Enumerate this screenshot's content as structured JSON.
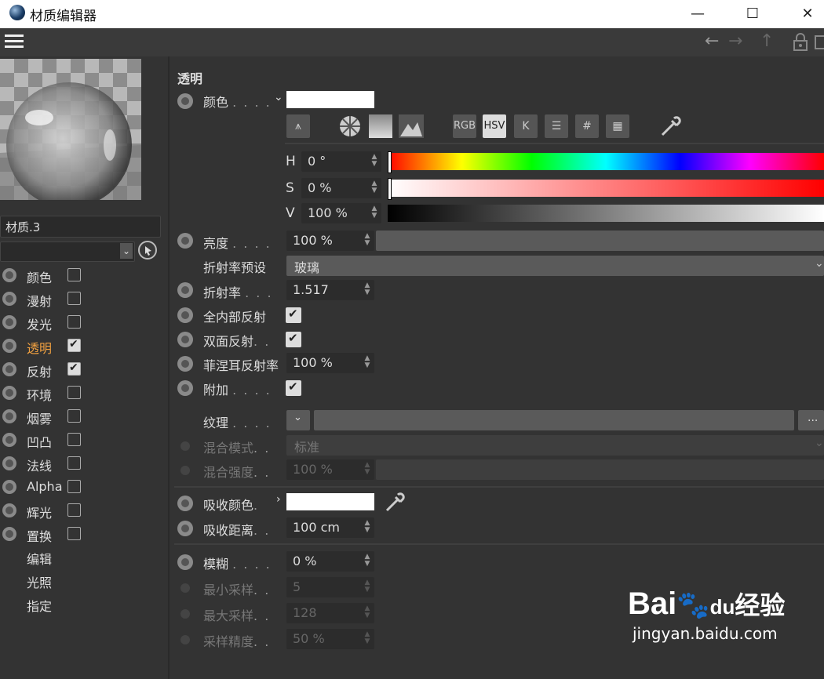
{
  "window": {
    "title": "材质编辑器"
  },
  "window_controls": {
    "minimize": "—",
    "maximize": "☐",
    "close": "✕"
  },
  "toolbar": {
    "icons": [
      "hamburger-menu-icon",
      "arrow-left-icon",
      "arrow-right-icon",
      "arrow-up-icon",
      "lock-icon",
      "new-window-icon"
    ]
  },
  "left_panel": {
    "material_name": "材质.3",
    "channels": [
      {
        "label": "颜色",
        "checked": false,
        "active": false
      },
      {
        "label": "漫射",
        "checked": false,
        "active": false
      },
      {
        "label": "发光",
        "checked": false,
        "active": false
      },
      {
        "label": "透明",
        "checked": true,
        "active": true
      },
      {
        "label": "反射",
        "checked": true,
        "active": false
      },
      {
        "label": "环境",
        "checked": false,
        "active": false
      },
      {
        "label": "烟雾",
        "checked": false,
        "active": false
      },
      {
        "label": "凹凸",
        "checked": false,
        "active": false
      },
      {
        "label": "法线",
        "checked": false,
        "active": false
      },
      {
        "label": "Alpha",
        "checked": false,
        "active": false
      },
      {
        "label": "辉光",
        "checked": false,
        "active": false
      },
      {
        "label": "置换",
        "checked": false,
        "active": false
      }
    ],
    "extra_items": [
      "编辑",
      "光照",
      "指定"
    ]
  },
  "section_title": "透明",
  "color": {
    "label": "颜色",
    "swatch": "#ffffff",
    "mode_buttons": [
      "RGB",
      "HSV",
      "K",
      "#"
    ],
    "h_label": "H",
    "h_value": "0 °",
    "s_label": "S",
    "s_value": "0 %",
    "v_label": "V",
    "v_value": "100 %"
  },
  "brightness": {
    "label": "亮度",
    "value": "100 %",
    "fill": 1.0
  },
  "ior_preset": {
    "label": "折射率预设",
    "value": "玻璃"
  },
  "ior": {
    "label": "折射率",
    "value": "1.517"
  },
  "total_internal_reflection": {
    "label": "全内部反射",
    "checked": true
  },
  "double_sided": {
    "label": "双面反射",
    "checked": true
  },
  "fresnel": {
    "label": "菲涅耳反射率",
    "value": "100 %"
  },
  "additive": {
    "label": "附加",
    "checked": true
  },
  "texture": {
    "label": "纹理",
    "more": "..."
  },
  "blend_mode": {
    "label": "混合模式",
    "value": "标准"
  },
  "blend_strength": {
    "label": "混合强度",
    "value": "100 %"
  },
  "absorption_color": {
    "label": "吸收颜色",
    "swatch": "#ffffff"
  },
  "absorption_distance": {
    "label": "吸收距离",
    "value": "100 cm"
  },
  "blur": {
    "label": "模糊",
    "value": "0 %"
  },
  "min_samples": {
    "label": "最小采样",
    "value": "5"
  },
  "max_samples": {
    "label": "最大采样",
    "value": "128"
  },
  "accuracy": {
    "label": "采样精度",
    "value": "50 %"
  },
  "watermark": {
    "brand": "Bai",
    "brand2": "du",
    "brand3": "经验",
    "url": "jingyan.baidu.com"
  }
}
